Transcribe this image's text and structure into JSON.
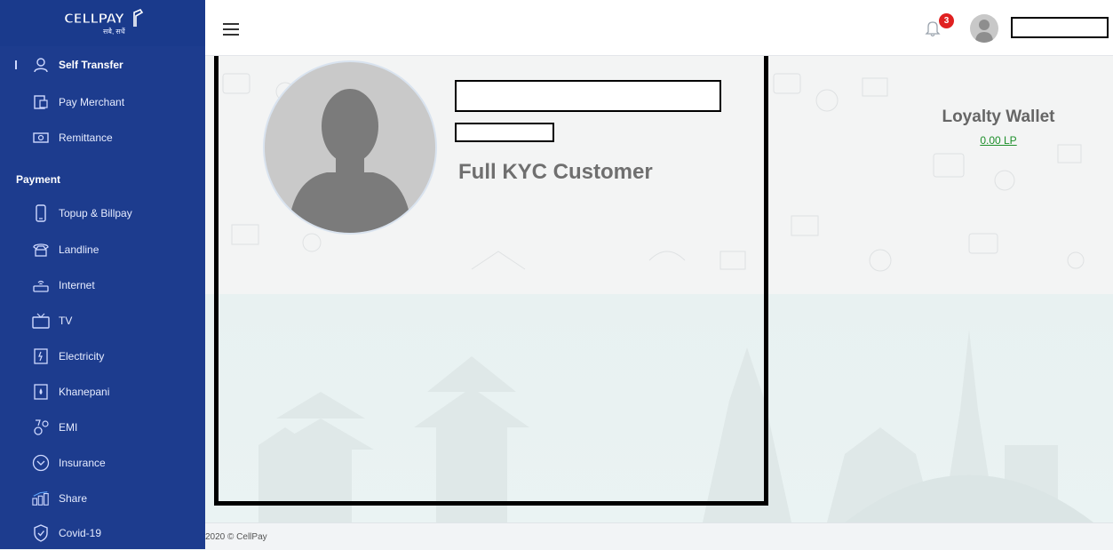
{
  "brand": {
    "name": "CELLPAY",
    "tagline": "सबै, सधैं"
  },
  "sidebar": {
    "top_items": [
      {
        "label": "Self Transfer",
        "icon": "user-icon"
      },
      {
        "label": "Pay Merchant",
        "icon": "merchant-icon"
      },
      {
        "label": "Remittance",
        "icon": "remittance-icon"
      }
    ],
    "section_title": "Payment",
    "payment_items": [
      {
        "label": "Topup & Billpay",
        "icon": "mobile-icon"
      },
      {
        "label": "Landline",
        "icon": "telephone-icon"
      },
      {
        "label": "Internet",
        "icon": "router-icon"
      },
      {
        "label": "TV",
        "icon": "tv-icon"
      },
      {
        "label": "Electricity",
        "icon": "electricity-icon"
      },
      {
        "label": "Khanepani",
        "icon": "water-icon"
      },
      {
        "label": "EMI",
        "icon": "emi-icon"
      },
      {
        "label": "Insurance",
        "icon": "shield-icon"
      },
      {
        "label": "Share",
        "icon": "share-chart-icon"
      },
      {
        "label": "Covid-19",
        "icon": "covid-shield-icon"
      }
    ]
  },
  "header": {
    "notification_count": "3"
  },
  "profile": {
    "kyc_status": "Full KYC Customer"
  },
  "loyalty": {
    "title": "Loyalty Wallet",
    "value": "0.00 LP"
  },
  "footer": {
    "text": "2020 © CellPay"
  },
  "colors": {
    "sidebar": "#1d3c8e",
    "badge": "#e02020",
    "loyalty_value": "#1e8f2b"
  }
}
